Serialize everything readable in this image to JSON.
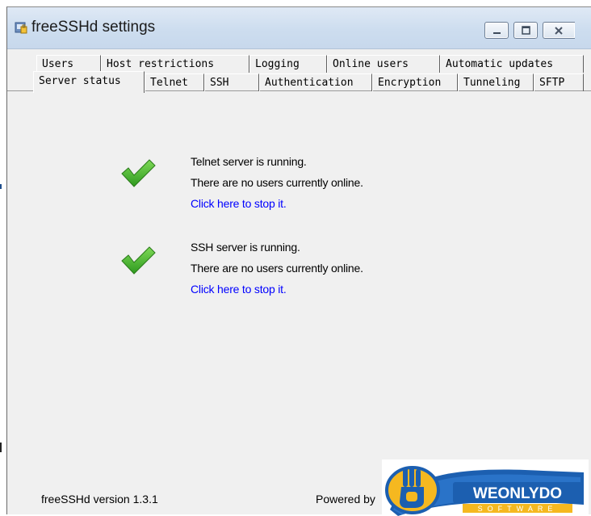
{
  "window": {
    "title": "freeSSHd settings",
    "icon": "freesshd-app-icon"
  },
  "titlebar_buttons": {
    "minimize": "minimize-icon",
    "maximize": "maximize-icon",
    "close": "close-icon"
  },
  "tabs": {
    "back_row": [
      {
        "label": "Users"
      },
      {
        "label": "Host restrictions"
      },
      {
        "label": "Logging"
      },
      {
        "label": "Online users"
      },
      {
        "label": "Automatic updates"
      }
    ],
    "front_row": [
      {
        "label": "Server status",
        "selected": true
      },
      {
        "label": "Telnet"
      },
      {
        "label": "SSH"
      },
      {
        "label": "Authentication"
      },
      {
        "label": "Encryption"
      },
      {
        "label": "Tunneling"
      },
      {
        "label": "SFTP"
      }
    ]
  },
  "telnet": {
    "status": "Telnet server is running.",
    "users": "There are no users currently online.",
    "action": "Click here to stop it.",
    "icon": "green-check-icon"
  },
  "ssh": {
    "status": "SSH server is running.",
    "users": "There are no users currently online.",
    "action": "Click here to stop it.",
    "icon": "green-check-icon"
  },
  "footer": {
    "version": "freeSSHd version 1.3.1",
    "powered_by": "Powered by",
    "logo_text": "WEONLYDO",
    "logo_subtext": "SOFTWARE"
  },
  "colors": {
    "link": "#0000ff",
    "check_green": "#3fae2a",
    "logo_blue": "#1c5fb0",
    "logo_yellow": "#f5b820"
  }
}
